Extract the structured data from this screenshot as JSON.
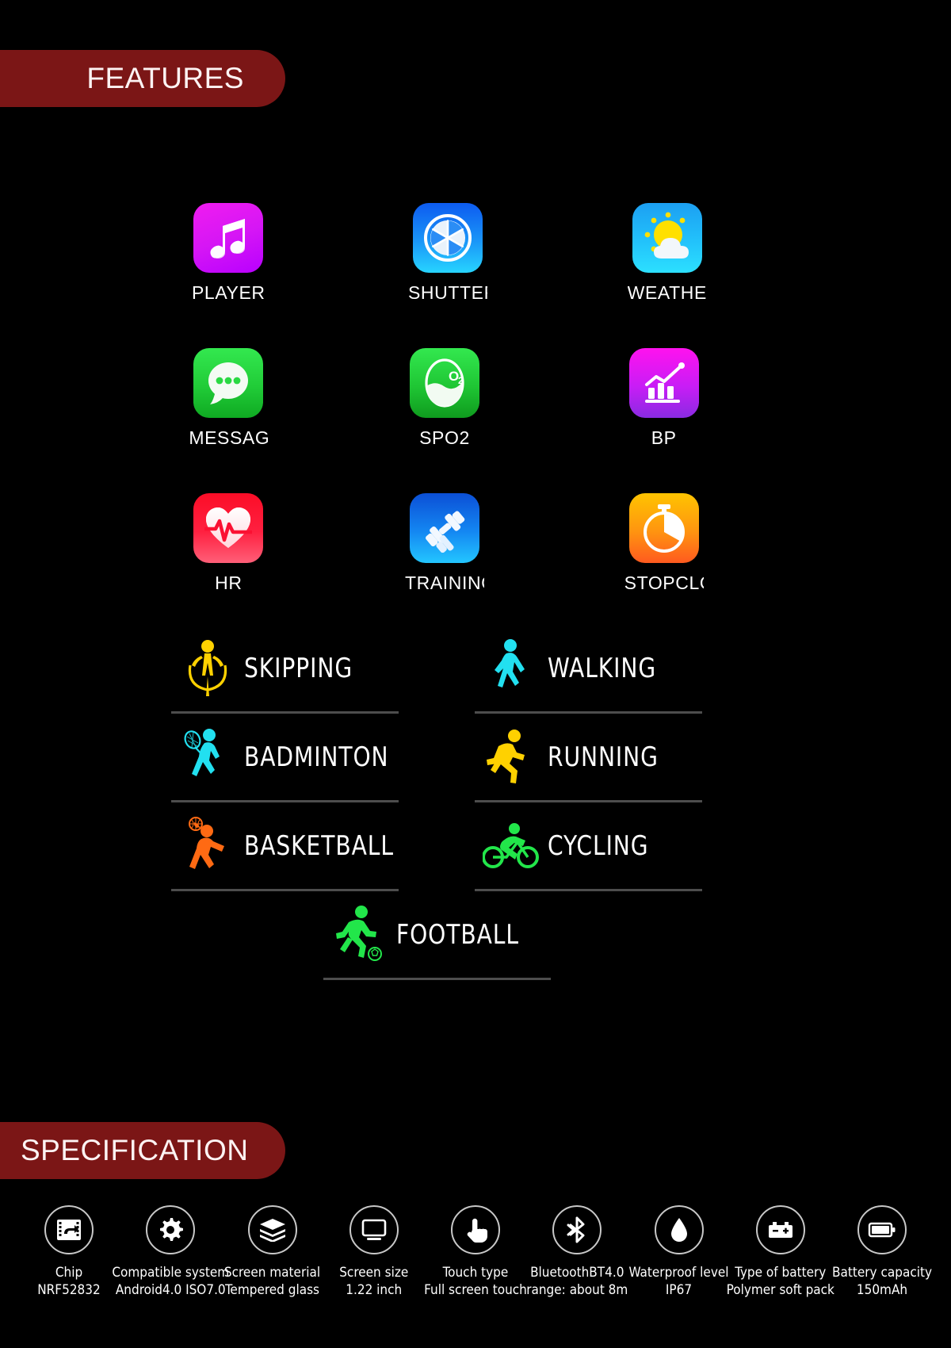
{
  "sections": {
    "features_title": "FEATURES",
    "specification_title": "SPECIFICATION"
  },
  "colors": {
    "banner": "#7b1616",
    "background": "#000000",
    "text": "#ffffff",
    "rule": "#4d4d4d"
  },
  "apps": [
    {
      "label": "PLAYER",
      "icon": "music-note-icon",
      "grad_from": "#f01cf0",
      "grad_to": "#b800ff"
    },
    {
      "label": "SHUTTER",
      "icon": "camera-aperture-icon",
      "grad_from": "#0d5bf0",
      "grad_to": "#22ccff"
    },
    {
      "label": "WEATHER",
      "icon": "sun-cloud-icon",
      "grad_from": "#20a8f5",
      "grad_to": "#25d6ff"
    },
    {
      "label": "MESSAGE",
      "icon": "chat-bubble-icon",
      "grad_from": "#2de64a",
      "grad_to": "#14b82c"
    },
    {
      "label": "SPO2",
      "icon": "oxygen-drop-icon",
      "grad_from": "#2de64a",
      "grad_to": "#14a524"
    },
    {
      "label": "BP",
      "icon": "bar-chart-icon",
      "grad_from": "#ff12ee",
      "grad_to": "#8a2be2"
    },
    {
      "label": "HR",
      "icon": "heart-pulse-icon",
      "grad_from": "#ff1a33",
      "grad_to": "#ff4d6a"
    },
    {
      "label": "TRAINING",
      "icon": "dumbbell-icon",
      "grad_from": "#0b4fd6",
      "grad_to": "#23c6ff"
    },
    {
      "label": "STOPCLOCK",
      "icon": "stopwatch-icon",
      "grad_from": "#ffc400",
      "grad_to": "#ff5a1f"
    }
  ],
  "sports": [
    {
      "label": "SKIPPING",
      "icon": "jump-rope-icon",
      "color": "#ffd100"
    },
    {
      "label": "WALKING",
      "icon": "walking-icon",
      "color": "#22e0f0"
    },
    {
      "label": "BADMINTON",
      "icon": "badminton-icon",
      "color": "#22e0f0"
    },
    {
      "label": "RUNNING",
      "icon": "running-icon",
      "color": "#ffd100"
    },
    {
      "label": "BASKETBALL",
      "icon": "basketball-icon",
      "color": "#ff6a13"
    },
    {
      "label": "CYCLING",
      "icon": "cycling-icon",
      "color": "#22e64a"
    },
    {
      "label": "FOOTBALL",
      "icon": "football-icon",
      "color": "#22e64a"
    }
  ],
  "specifications": [
    {
      "icon": "chip-icon",
      "title": "Chip",
      "value": "NRF52832"
    },
    {
      "icon": "gear-icon",
      "title": "Compatible system",
      "value": "Android4.0 ISO7.0"
    },
    {
      "icon": "layers-icon",
      "title": "Screen material",
      "value": "Tempered glass"
    },
    {
      "icon": "monitor-icon",
      "title": "Screen size",
      "value": "1.22 inch"
    },
    {
      "icon": "touch-hand-icon",
      "title": "Touch type",
      "value": "Full screen touch"
    },
    {
      "icon": "bluetooth-icon",
      "title": "BluetoothBT4.0",
      "value": "range: about 8m"
    },
    {
      "icon": "water-drop-icon",
      "title": "Waterproof level",
      "value": "IP67"
    },
    {
      "icon": "battery-cell-icon",
      "title": "Type of battery",
      "value": "Polymer soft pack"
    },
    {
      "icon": "battery-icon",
      "title": "Battery capacity",
      "value": "150mAh"
    }
  ]
}
